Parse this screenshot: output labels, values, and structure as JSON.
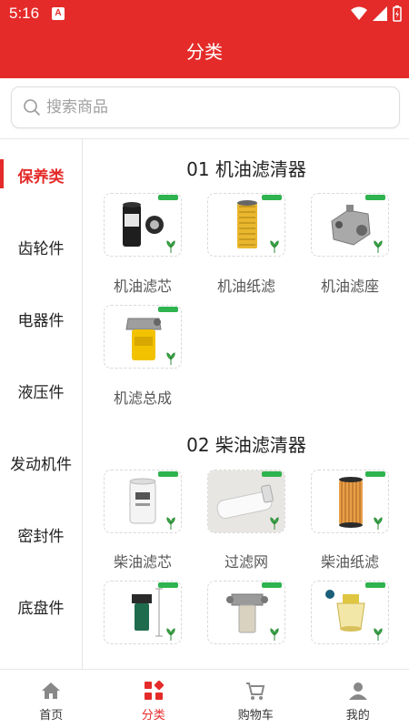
{
  "status": {
    "time": "5:16",
    "app_badge": "A"
  },
  "header": {
    "title": "分类"
  },
  "search": {
    "placeholder": "搜索商品"
  },
  "sidebar": {
    "items": [
      {
        "label": "保养类",
        "active": true
      },
      {
        "label": "齿轮件"
      },
      {
        "label": "电器件"
      },
      {
        "label": "液压件"
      },
      {
        "label": "发动机件"
      },
      {
        "label": "密封件"
      },
      {
        "label": "底盘件"
      }
    ]
  },
  "sections": [
    {
      "title": "01 机油滤清器",
      "products": [
        {
          "label": "机油滤芯",
          "icon": "oil-filter-cartridge"
        },
        {
          "label": "机油纸滤",
          "icon": "paper-filter"
        },
        {
          "label": "机油滤座",
          "icon": "filter-base"
        },
        {
          "label": "机滤总成",
          "icon": "filter-assembly"
        }
      ]
    },
    {
      "title": "02 柴油滤清器",
      "products": [
        {
          "label": "柴油滤芯",
          "icon": "diesel-filter-cartridge"
        },
        {
          "label": "过滤网",
          "icon": "filter-screen"
        },
        {
          "label": "柴油纸滤",
          "icon": "diesel-paper-filter"
        },
        {
          "label": "",
          "icon": "water-separator"
        },
        {
          "label": "",
          "icon": "filter-housing-assembly"
        },
        {
          "label": "",
          "icon": "transparent-filter-cup"
        }
      ]
    }
  ],
  "tabbar": {
    "items": [
      {
        "label": "首页",
        "icon": "home-icon"
      },
      {
        "label": "分类",
        "icon": "category-icon",
        "active": true
      },
      {
        "label": "购物车",
        "icon": "cart-icon"
      },
      {
        "label": "我的",
        "icon": "user-icon"
      }
    ]
  },
  "colors": {
    "brand": "#e42b29",
    "tag_green": "#2fb34f"
  }
}
